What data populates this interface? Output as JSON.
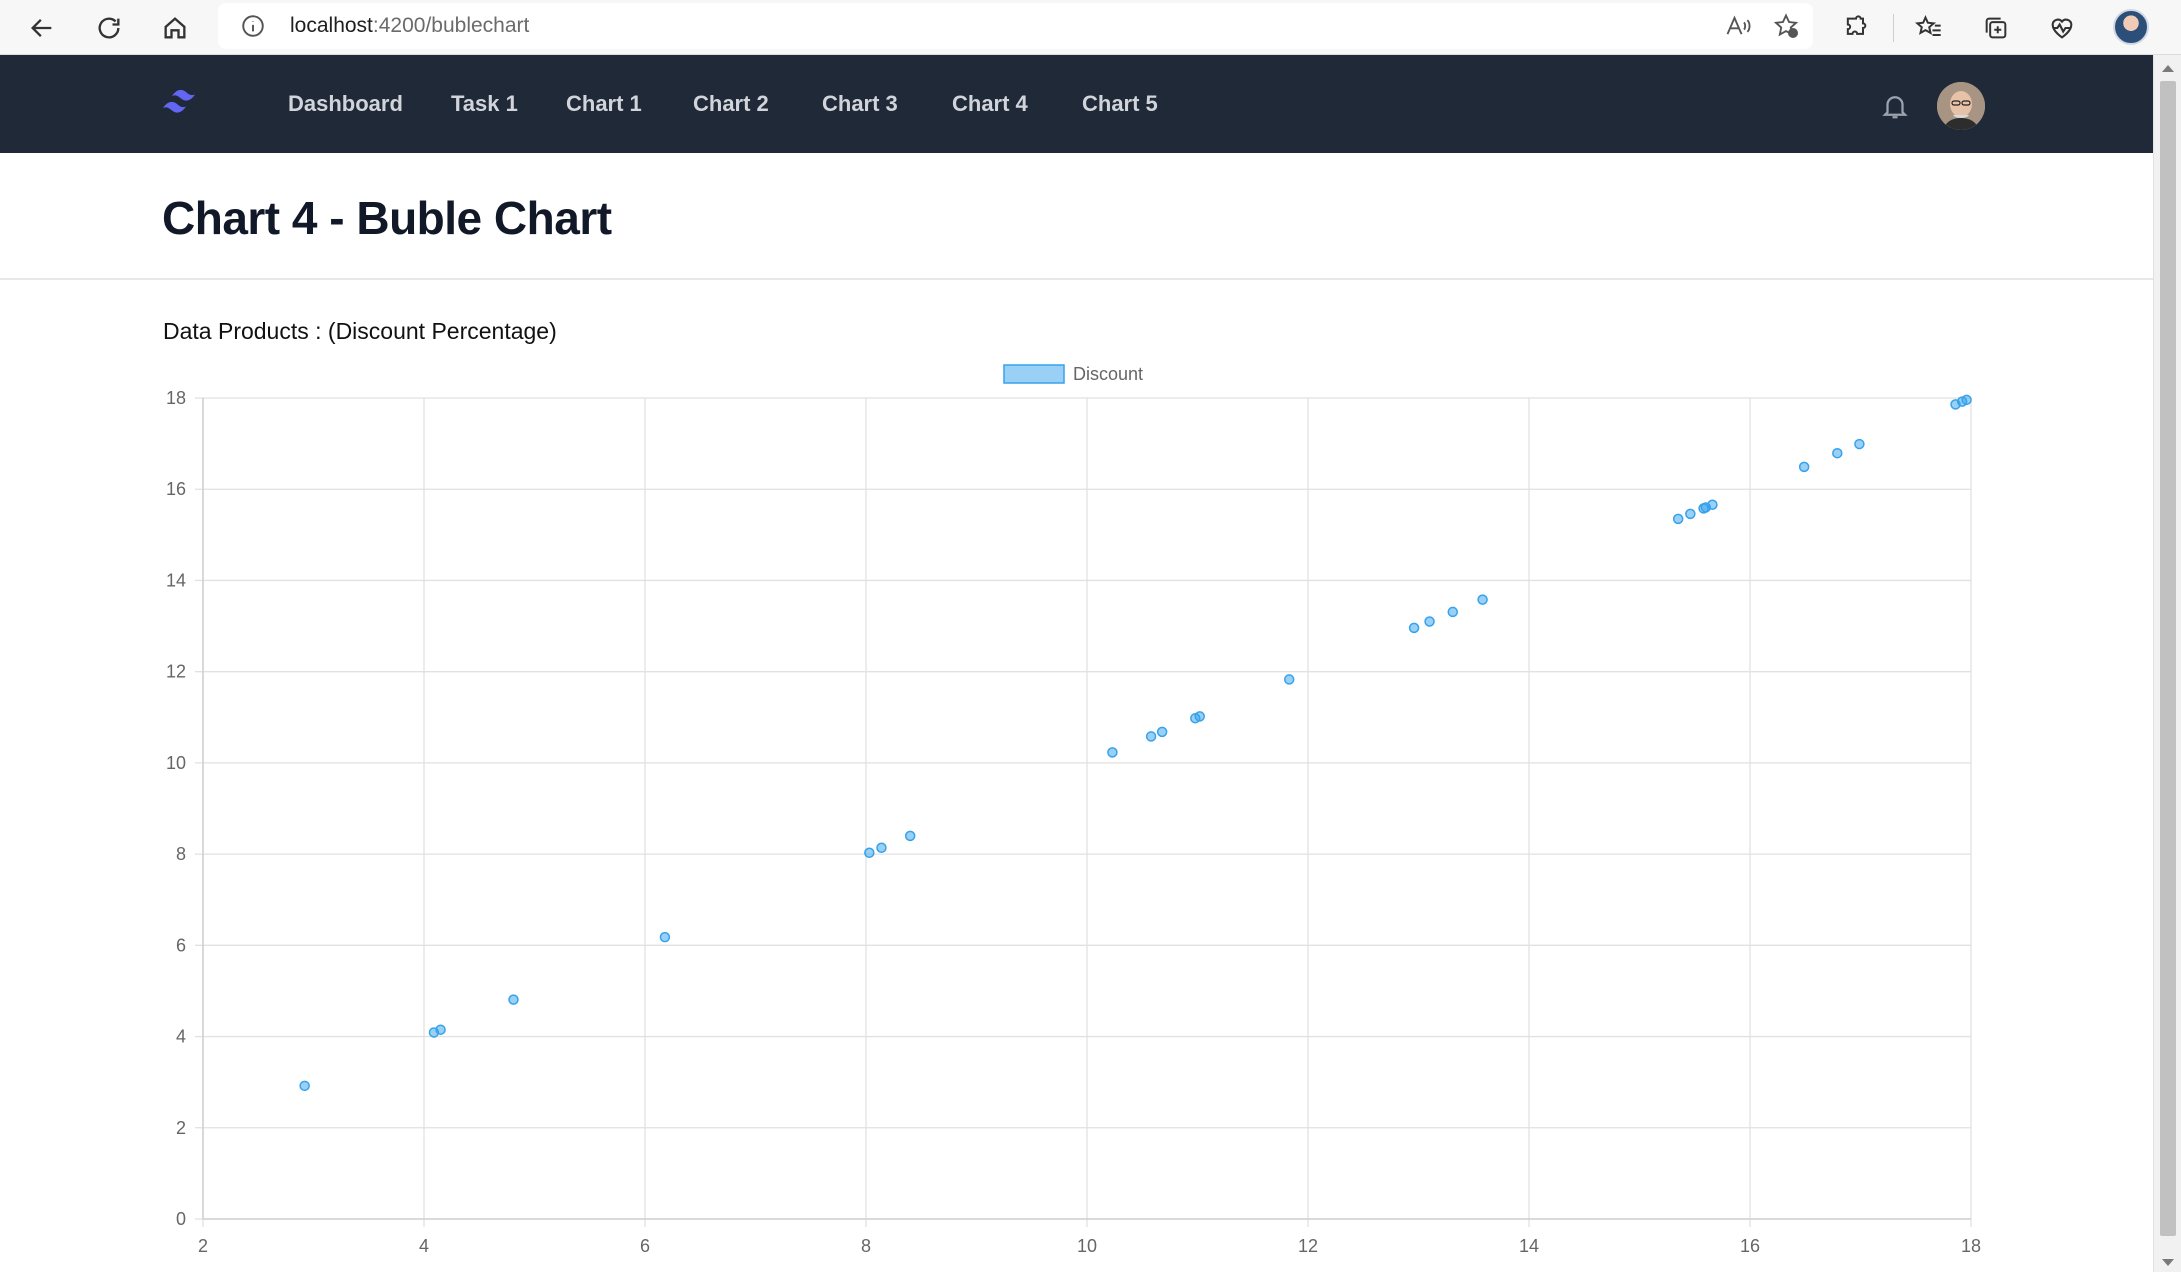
{
  "browser": {
    "url_host": "localhost",
    "url_path": ":4200/bublechart"
  },
  "nav": {
    "links": [
      {
        "label": "Dashboard"
      },
      {
        "label": "Task 1"
      },
      {
        "label": "Chart 1"
      },
      {
        "label": "Chart 2"
      },
      {
        "label": "Chart 3"
      },
      {
        "label": "Chart 4"
      },
      {
        "label": "Chart 5"
      }
    ]
  },
  "header": {
    "title": "Chart 4 - Buble Chart"
  },
  "main": {
    "subtitle": "Data Products : (Discount Percentage)"
  },
  "chart_data": {
    "type": "scatter",
    "title": "",
    "xlabel": "",
    "ylabel": "",
    "xlim": [
      2,
      18
    ],
    "ylim": [
      0,
      18
    ],
    "x_ticks": [
      2,
      4,
      6,
      8,
      10,
      12,
      14,
      16,
      18
    ],
    "y_ticks": [
      0,
      2,
      4,
      6,
      8,
      10,
      12,
      14,
      16,
      18
    ],
    "grid": true,
    "legend_position": "top",
    "series": [
      {
        "name": "Discount",
        "color": "#36a2eb",
        "fill": "rgba(54,162,235,0.5)",
        "points": [
          {
            "x": 2.92,
            "y": 2.92
          },
          {
            "x": 4.09,
            "y": 4.09
          },
          {
            "x": 4.15,
            "y": 4.15
          },
          {
            "x": 4.81,
            "y": 4.81
          },
          {
            "x": 6.18,
            "y": 6.18
          },
          {
            "x": 8.03,
            "y": 8.03
          },
          {
            "x": 8.14,
            "y": 8.14
          },
          {
            "x": 8.4,
            "y": 8.4
          },
          {
            "x": 10.23,
            "y": 10.23
          },
          {
            "x": 10.58,
            "y": 10.58
          },
          {
            "x": 10.68,
            "y": 10.68
          },
          {
            "x": 10.98,
            "y": 10.98
          },
          {
            "x": 11.02,
            "y": 11.02
          },
          {
            "x": 11.83,
            "y": 11.83
          },
          {
            "x": 12.96,
            "y": 12.96
          },
          {
            "x": 13.1,
            "y": 13.1
          },
          {
            "x": 13.31,
            "y": 13.31
          },
          {
            "x": 13.58,
            "y": 13.58
          },
          {
            "x": 15.35,
            "y": 15.35
          },
          {
            "x": 15.46,
            "y": 15.46
          },
          {
            "x": 15.58,
            "y": 15.58
          },
          {
            "x": 15.6,
            "y": 15.6
          },
          {
            "x": 15.66,
            "y": 15.66
          },
          {
            "x": 16.49,
            "y": 16.49
          },
          {
            "x": 16.79,
            "y": 16.79
          },
          {
            "x": 16.99,
            "y": 16.99
          },
          {
            "x": 17.86,
            "y": 17.86
          },
          {
            "x": 17.92,
            "y": 17.92
          },
          {
            "x": 17.96,
            "y": 17.96
          }
        ]
      }
    ]
  }
}
